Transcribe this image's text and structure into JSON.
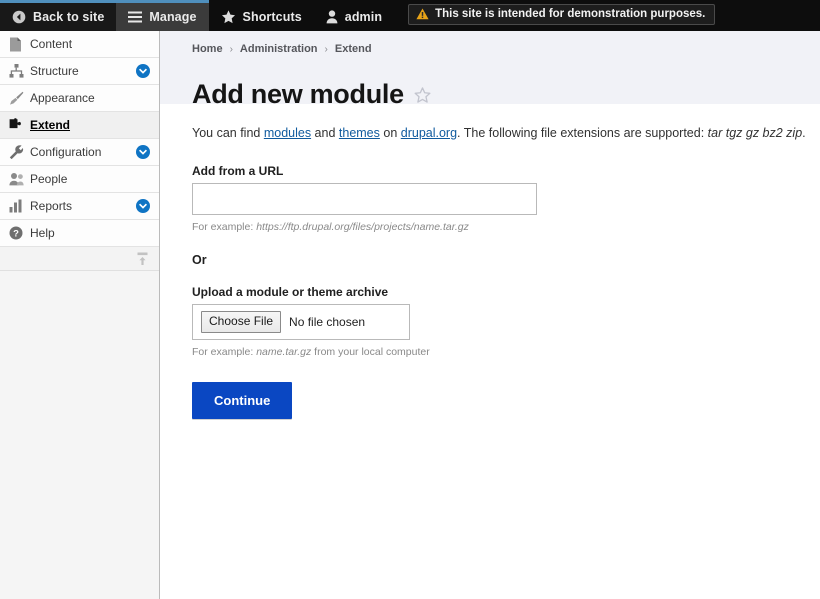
{
  "toolbar": {
    "back_to_site": "Back to site",
    "manage": "Manage",
    "shortcuts": "Shortcuts",
    "account": "admin",
    "demo_warning": "This site is intended for demonstration purposes.",
    "accent_color": "#4f8fbd",
    "background_color": "#0d0d0d"
  },
  "sidebar": {
    "items": [
      {
        "label": "Content",
        "icon": "content-page-icon",
        "has_chevron": false,
        "active": false
      },
      {
        "label": "Structure",
        "icon": "structure-icon",
        "has_chevron": true,
        "active": false
      },
      {
        "label": "Appearance",
        "icon": "paintbrush-icon",
        "has_chevron": false,
        "active": false
      },
      {
        "label": "Extend",
        "icon": "puzzle-piece-icon",
        "has_chevron": false,
        "active": true
      },
      {
        "label": "Configuration",
        "icon": "wrench-icon",
        "has_chevron": true,
        "active": false
      },
      {
        "label": "People",
        "icon": "people-icon",
        "has_chevron": false,
        "active": false
      },
      {
        "label": "Reports",
        "icon": "bar-chart-icon",
        "has_chevron": true,
        "active": false
      },
      {
        "label": "Help",
        "icon": "question-mark-icon",
        "has_chevron": false,
        "active": false
      }
    ],
    "orientation_toggle_icon": "horizontal-orientation-toggle-icon",
    "chevron_color": "#0f74c4"
  },
  "breadcrumb": {
    "items": [
      "Home",
      "Administration",
      "Extend"
    ],
    "separator": "›"
  },
  "page": {
    "title": "Add new module",
    "bookmark_icon": "star-outline-icon",
    "header_background": "#f1f2f7"
  },
  "intro": {
    "part1": "You can find ",
    "link_modules": "modules",
    "part2": " and ",
    "link_themes": "themes",
    "part3": " on ",
    "link_drupal": "drupal.org",
    "part4": ". The following file extensions are supported: ",
    "extensions": "tar tgz gz bz2 zip",
    "part5": "."
  },
  "form": {
    "url_label": "Add from a URL",
    "url_value": "",
    "url_placeholder": "",
    "url_help_lead": "For example: ",
    "url_help_example": "https://ftp.drupal.org/files/projects/name.tar.gz",
    "or_label": "Or",
    "upload_label": "Upload a module or theme archive",
    "choose_file_label": "Choose File",
    "no_file_chosen": "No file chosen",
    "upload_help_lead": "For example: ",
    "upload_help_example": "name.tar.gz",
    "upload_help_tail": " from your local computer",
    "submit_label": "Continue",
    "submit_color": "#0a47c2"
  }
}
